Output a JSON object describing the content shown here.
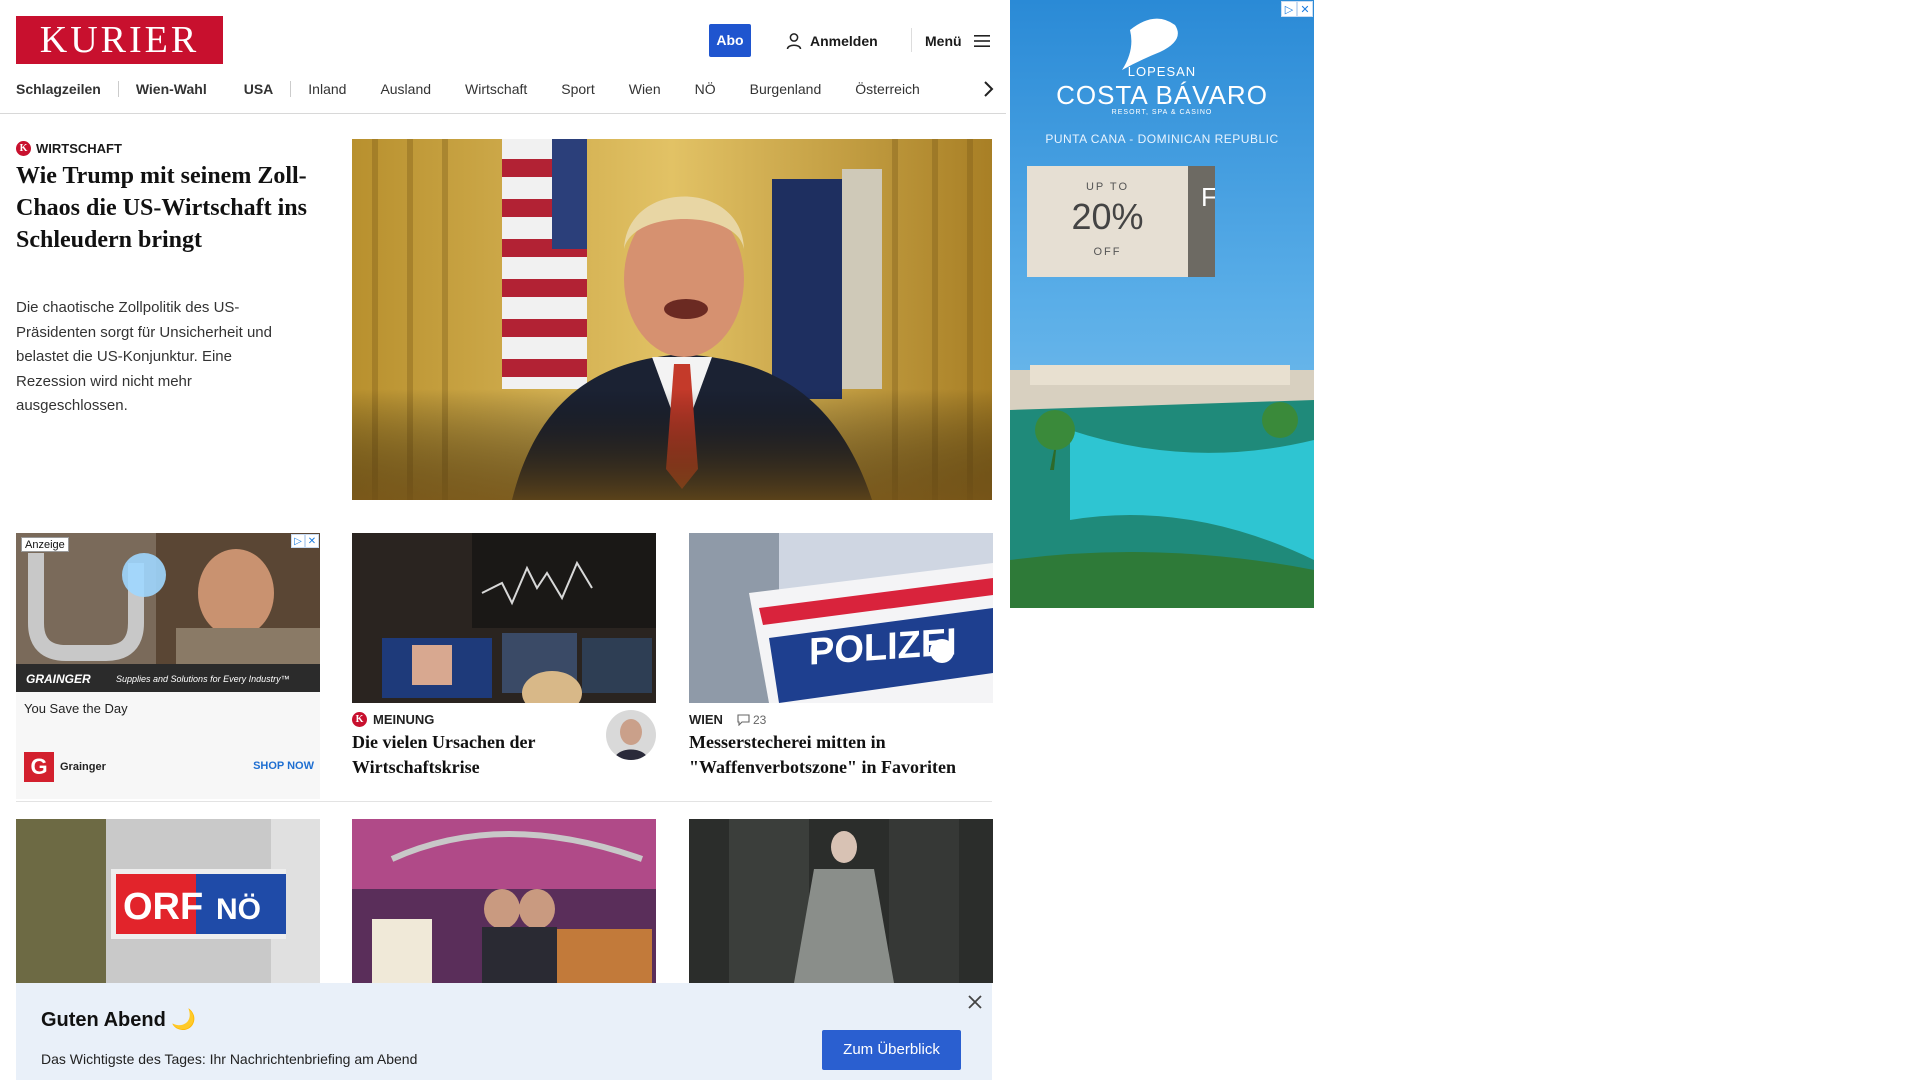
{
  "header": {
    "logo_text": "KURIER",
    "abo_label": "Abo",
    "login_label": "Anmelden",
    "menu_label": "Menü",
    "brand_color": "#c8102e",
    "accent_color": "#1f55cf",
    "nav": [
      "Schlagzeilen",
      "Wien-Wahl",
      "USA",
      "Inland",
      "Ausland",
      "Wirtschaft",
      "Sport",
      "Wien",
      "NÖ",
      "Burgenland",
      "Österreich"
    ]
  },
  "hero": {
    "section": "Wirtschaft",
    "badge": "K",
    "title": "Wie Trump mit seinem Zoll-Chaos die US-Wirtschaft ins Schleudern bringt",
    "description": "Die chaotische Zollpolitik des US-Präsidenten sorgt für Unsicherheit und belastet die US-Konjunktur. Eine Rezession wird nicht mehr ausgeschlossen."
  },
  "ad_card": {
    "label": "Anzeige",
    "image_banner_brand": "GRAINGER",
    "image_banner_tagline": "Supplies and Solutions for Every Industry™",
    "text": "You Save the Day",
    "advertiser": "Grainger",
    "advertiser_logo": "G",
    "cta": "SHOP NOW"
  },
  "cards": [
    {
      "section": "Meinung",
      "badge": "K",
      "title": "Die vielen Ursachen der Wirtschaftskrise"
    },
    {
      "section": "Wien",
      "comments": "23",
      "police_text": "POLIZEI",
      "title": "Messerstecherei mitten in \"Waffenverbotszone\" in Favoriten"
    }
  ],
  "row2": {
    "orf_text": "ORF",
    "orf_sub": "NÖ"
  },
  "banner": {
    "title": "Guten Abend 🌙",
    "text": "Das Wichtigste des Tages: Ihr Nachrichtenbriefing am Abend",
    "button": "Zum Überblick"
  },
  "side_ad": {
    "brand_small": "LOPESAN",
    "brand": "COSTA BÁVARO",
    "brand_sub": "RESORT, SPA & CASINO",
    "region": "PUNTA CANA - DOMINICAN REPUBLIC",
    "offer_upto": "UP TO",
    "offer_pct": "20%",
    "offer_off": "OFF",
    "offer_side": "FR $"
  }
}
